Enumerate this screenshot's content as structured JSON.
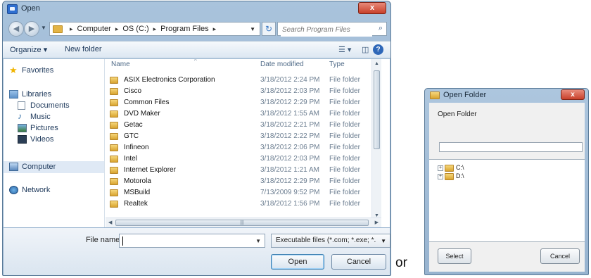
{
  "open_dialog": {
    "title": "Open",
    "close_label": "x",
    "nav": {
      "back": "◀",
      "forward": "▶",
      "history": "▼"
    },
    "address": {
      "crumbs": [
        "Computer",
        "OS (C:)",
        "Program Files"
      ],
      "separator": "▸",
      "dropdown": "▼"
    },
    "refresh": "↻",
    "search": {
      "placeholder": "Search Program Files",
      "icon": "⌕"
    },
    "toolbar": {
      "organize": "Organize ▾",
      "new_folder": "New folder",
      "view": "☰ ▾",
      "pane": "◫",
      "help": "?"
    },
    "sidebar": {
      "items": [
        {
          "label": "Favorites"
        },
        {
          "label": "Libraries"
        },
        {
          "label": "Documents"
        },
        {
          "label": "Music"
        },
        {
          "label": "Pictures"
        },
        {
          "label": "Videos"
        },
        {
          "label": "Computer"
        },
        {
          "label": "Network"
        }
      ]
    },
    "columns": {
      "name": "Name",
      "date": "Date modified",
      "type": "Type",
      "sort_indicator": "^"
    },
    "files": [
      {
        "name": "ASIX Electronics Corporation",
        "date": "3/18/2012 2:24 PM",
        "type": "File folder"
      },
      {
        "name": "Cisco",
        "date": "3/18/2012 2:03 PM",
        "type": "File folder"
      },
      {
        "name": "Common Files",
        "date": "3/18/2012 2:29 PM",
        "type": "File folder"
      },
      {
        "name": "DVD Maker",
        "date": "3/18/2012 1:55 AM",
        "type": "File folder"
      },
      {
        "name": "Getac",
        "date": "3/18/2012 2:21 PM",
        "type": "File folder"
      },
      {
        "name": "GTC",
        "date": "3/18/2012 2:22 PM",
        "type": "File folder"
      },
      {
        "name": "Infineon",
        "date": "3/18/2012 2:06 PM",
        "type": "File folder"
      },
      {
        "name": "Intel",
        "date": "3/18/2012 2:03 PM",
        "type": "File folder"
      },
      {
        "name": "Internet Explorer",
        "date": "3/18/2012 1:21 AM",
        "type": "File folder"
      },
      {
        "name": "Motorola",
        "date": "3/18/2012 2:29 PM",
        "type": "File folder"
      },
      {
        "name": "MSBuild",
        "date": "7/13/2009 9:52 PM",
        "type": "File folder"
      },
      {
        "name": "Realtek",
        "date": "3/18/2012 1:56 PM",
        "type": "File folder"
      }
    ],
    "scroll": {
      "up": "▲",
      "down": "▼",
      "left": "◀",
      "right": "▶",
      "grip": "|||"
    },
    "filename_label": "File name:",
    "filename_value": "",
    "filename_drop": "▼",
    "filetype": "Executable files (*.com; *.exe; *.",
    "filetype_drop": "▼",
    "open_label": "Open",
    "cancel_label": "Cancel"
  },
  "separator_text": "or",
  "folder_dialog": {
    "title": "Open Folder",
    "close_label": "x",
    "label": "Open Folder",
    "input_value": "",
    "tree": [
      {
        "expander": "+",
        "label": "C:\\"
      },
      {
        "expander": "+",
        "label": "D:\\"
      }
    ],
    "select_label": "Select",
    "cancel_label": "Cancel"
  }
}
